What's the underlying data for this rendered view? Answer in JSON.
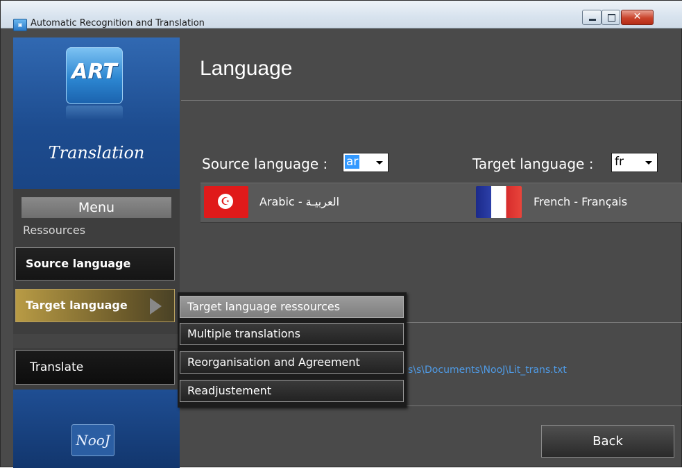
{
  "window": {
    "title": "Automatic Recognition and Translation",
    "icon": "app-icon"
  },
  "sidebar": {
    "brand_logo_text": "ART",
    "brand_text": "Translation",
    "menu_header": "Menu",
    "section_label": "Ressources",
    "items": [
      {
        "label": "Source language",
        "active": false
      },
      {
        "label": "Target language",
        "active": true
      },
      {
        "label": "Translate",
        "active": false
      }
    ],
    "bottom_logo_text": "NooJ"
  },
  "main": {
    "title": "Language",
    "source": {
      "label": "Source language :",
      "selected": "ar",
      "name": "Arabic - العربيـة"
    },
    "target": {
      "label": "Target language :",
      "selected": "fr",
      "name": "French - Français"
    },
    "file_path": "s\\s\\Documents\\NooJ\\Lit_trans.txt",
    "back_label": "Back"
  },
  "submenu": {
    "items": [
      {
        "label": "Target language ressources",
        "highlighted": true
      },
      {
        "label": "Multiple translations",
        "highlighted": false
      },
      {
        "label": "Reorganisation and Agreement",
        "highlighted": false
      },
      {
        "label": "Readjustement",
        "highlighted": false
      }
    ]
  },
  "colors": {
    "brand_blue": "#1d4c8f",
    "active_gold": "#b89b45",
    "path_link": "#4f9be6",
    "background": "#4a4a4a"
  }
}
